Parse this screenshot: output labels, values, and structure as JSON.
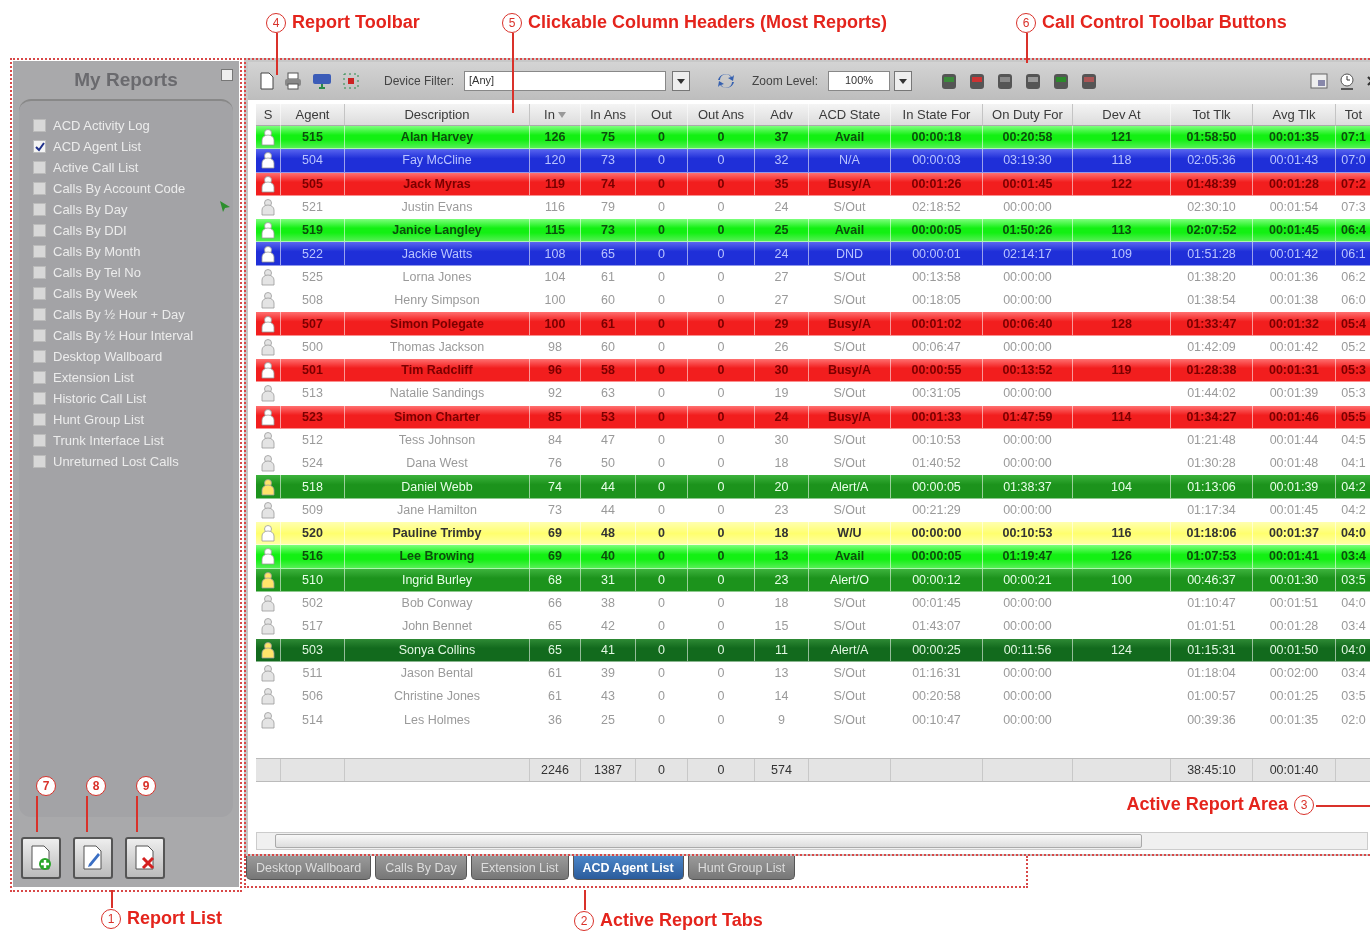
{
  "callouts": [
    {
      "number": "4",
      "label": "Report Toolbar"
    },
    {
      "number": "5",
      "label": "Clickable Column Headers (Most Reports)"
    },
    {
      "number": "6",
      "label": "Call Control Toolbar Buttons"
    },
    {
      "number": "3",
      "label": "Active Report Area"
    },
    {
      "number": "1",
      "label": "Report List"
    },
    {
      "number": "2",
      "label": "Active Report Tabs"
    }
  ],
  "markers": [
    {
      "number": "7"
    },
    {
      "number": "8"
    },
    {
      "number": "9"
    }
  ],
  "sidebar": {
    "title": "My Reports",
    "items": [
      {
        "label": "ACD Activity Log",
        "checked": false
      },
      {
        "label": "ACD Agent List",
        "checked": true
      },
      {
        "label": "Active Call List",
        "checked": false
      },
      {
        "label": "Calls By Account Code",
        "checked": false
      },
      {
        "label": "Calls By Day",
        "checked": false
      },
      {
        "label": "Calls By DDI",
        "checked": false
      },
      {
        "label": "Calls By Month",
        "checked": false
      },
      {
        "label": "Calls By Tel No",
        "checked": false
      },
      {
        "label": "Calls By Week",
        "checked": false
      },
      {
        "label": "Calls By ½ Hour + Day",
        "checked": false
      },
      {
        "label": "Calls By ½ Hour Interval",
        "checked": false
      },
      {
        "label": "Desktop Wallboard",
        "checked": false
      },
      {
        "label": "Extension List",
        "checked": false
      },
      {
        "label": "Historic Call List",
        "checked": false
      },
      {
        "label": "Hunt Group List",
        "checked": false
      },
      {
        "label": "Trunk Interface List",
        "checked": false
      },
      {
        "label": "Unreturned Lost Calls",
        "checked": false
      }
    ],
    "buttons": [
      {
        "kind": "add"
      },
      {
        "kind": "edit"
      },
      {
        "kind": "delete"
      }
    ]
  },
  "toolbar": {
    "device_filter_label": "Device Filter:",
    "device_filter_value": "[Any]",
    "zoom_label": "Zoom Level:",
    "zoom_value": "100%"
  },
  "table": {
    "columns": [
      {
        "label": "S",
        "sorted": false
      },
      {
        "label": "Agent",
        "sorted": false
      },
      {
        "label": "Description",
        "sorted": false
      },
      {
        "label": "In",
        "sorted": true
      },
      {
        "label": "In Ans",
        "sorted": false
      },
      {
        "label": "Out",
        "sorted": false
      },
      {
        "label": "Out Ans",
        "sorted": false
      },
      {
        "label": "Adv",
        "sorted": false
      },
      {
        "label": "ACD State",
        "sorted": false
      },
      {
        "label": "In State For",
        "sorted": false
      },
      {
        "label": "On Duty For",
        "sorted": false
      },
      {
        "label": "Dev At",
        "sorted": false
      },
      {
        "label": "Tot Tlk",
        "sorted": false
      },
      {
        "label": "Avg Tlk",
        "sorted": false
      },
      {
        "label": "Tot",
        "sorted": false
      }
    ],
    "rows": [
      {
        "kind": "avail",
        "agent": "515",
        "description": "Alan Harvey",
        "in": "126",
        "in_ans": "75",
        "out": "0",
        "out_ans": "0",
        "adv": "37",
        "acd_state": "Avail",
        "in_state_for": "00:00:18",
        "on_duty_for": "00:20:58",
        "dev_at": "121",
        "tot_tlk": "01:58:50",
        "avg_tlk": "00:01:35",
        "tot": "07:1"
      },
      {
        "kind": "unavailable",
        "agent": "504",
        "description": "Fay McCline",
        "in": "120",
        "in_ans": "73",
        "out": "0",
        "out_ans": "0",
        "adv": "32",
        "acd_state": "N/A",
        "in_state_for": "00:00:03",
        "on_duty_for": "03:19:30",
        "dev_at": "118",
        "tot_tlk": "02:05:36",
        "avg_tlk": "00:01:43",
        "tot": "07:0"
      },
      {
        "kind": "busy",
        "agent": "505",
        "description": "Jack Myras",
        "in": "119",
        "in_ans": "74",
        "out": "0",
        "out_ans": "0",
        "adv": "35",
        "acd_state": "Busy/A",
        "in_state_for": "00:01:26",
        "on_duty_for": "00:01:45",
        "dev_at": "122",
        "tot_tlk": "01:48:39",
        "avg_tlk": "00:01:28",
        "tot": "07:2"
      },
      {
        "kind": "signedout",
        "agent": "521",
        "description": "Justin Evans",
        "in": "116",
        "in_ans": "79",
        "out": "0",
        "out_ans": "0",
        "adv": "24",
        "acd_state": "S/Out",
        "in_state_for": "02:18:52",
        "on_duty_for": "00:00:00",
        "tot_tlk": "02:30:10",
        "avg_tlk": "00:01:54",
        "tot": "07:3"
      },
      {
        "kind": "avail",
        "agent": "519",
        "description": "Janice Langley",
        "in": "115",
        "in_ans": "73",
        "out": "0",
        "out_ans": "0",
        "adv": "25",
        "acd_state": "Avail",
        "in_state_for": "00:00:05",
        "on_duty_for": "01:50:26",
        "dev_at": "113",
        "tot_tlk": "02:07:52",
        "avg_tlk": "00:01:45",
        "tot": "06:4"
      },
      {
        "kind": "unavailable",
        "agent": "522",
        "description": "Jackie Watts",
        "in": "108",
        "in_ans": "65",
        "out": "0",
        "out_ans": "0",
        "adv": "24",
        "acd_state": "DND",
        "in_state_for": "00:00:01",
        "on_duty_for": "02:14:17",
        "dev_at": "109",
        "tot_tlk": "01:51:28",
        "avg_tlk": "00:01:42",
        "tot": "06:1"
      },
      {
        "kind": "signedout",
        "agent": "525",
        "description": "Lorna Jones",
        "in": "104",
        "in_ans": "61",
        "out": "0",
        "out_ans": "0",
        "adv": "27",
        "acd_state": "S/Out",
        "in_state_for": "00:13:58",
        "on_duty_for": "00:00:00",
        "tot_tlk": "01:38:20",
        "avg_tlk": "00:01:36",
        "tot": "06:2"
      },
      {
        "kind": "signedout",
        "agent": "508",
        "description": "Henry Simpson",
        "in": "100",
        "in_ans": "60",
        "out": "0",
        "out_ans": "0",
        "adv": "27",
        "acd_state": "S/Out",
        "in_state_for": "00:18:05",
        "on_duty_for": "00:00:00",
        "tot_tlk": "01:38:54",
        "avg_tlk": "00:01:38",
        "tot": "06:0"
      },
      {
        "kind": "busy",
        "agent": "507",
        "description": "Simon Polegate",
        "in": "100",
        "in_ans": "61",
        "out": "0",
        "out_ans": "0",
        "adv": "29",
        "acd_state": "Busy/A",
        "in_state_for": "00:01:02",
        "on_duty_for": "00:06:40",
        "dev_at": "128",
        "tot_tlk": "01:33:47",
        "avg_tlk": "00:01:32",
        "tot": "05:4"
      },
      {
        "kind": "signedout",
        "agent": "500",
        "description": "Thomas Jackson",
        "in": "98",
        "in_ans": "60",
        "out": "0",
        "out_ans": "0",
        "adv": "26",
        "acd_state": "S/Out",
        "in_state_for": "00:06:47",
        "on_duty_for": "00:00:00",
        "tot_tlk": "01:42:09",
        "avg_tlk": "00:01:42",
        "tot": "05:2"
      },
      {
        "kind": "busy",
        "agent": "501",
        "description": "Tim Radcliff",
        "in": "96",
        "in_ans": "58",
        "out": "0",
        "out_ans": "0",
        "adv": "30",
        "acd_state": "Busy/A",
        "in_state_for": "00:00:55",
        "on_duty_for": "00:13:52",
        "dev_at": "119",
        "tot_tlk": "01:28:38",
        "avg_tlk": "00:01:31",
        "tot": "05:3"
      },
      {
        "kind": "signedout",
        "agent": "513",
        "description": "Natalie Sandings",
        "in": "92",
        "in_ans": "63",
        "out": "0",
        "out_ans": "0",
        "adv": "19",
        "acd_state": "S/Out",
        "in_state_for": "00:31:05",
        "on_duty_for": "00:00:00",
        "tot_tlk": "01:44:02",
        "avg_tlk": "00:01:39",
        "tot": "05:3"
      },
      {
        "kind": "busy",
        "agent": "523",
        "description": "Simon Charter",
        "in": "85",
        "in_ans": "53",
        "out": "0",
        "out_ans": "0",
        "adv": "24",
        "acd_state": "Busy/A",
        "in_state_for": "00:01:33",
        "on_duty_for": "01:47:59",
        "dev_at": "114",
        "tot_tlk": "01:34:27",
        "avg_tlk": "00:01:46",
        "tot": "05:5"
      },
      {
        "kind": "signedout",
        "agent": "512",
        "description": "Tess Johnson",
        "in": "84",
        "in_ans": "47",
        "out": "0",
        "out_ans": "0",
        "adv": "30",
        "acd_state": "S/Out",
        "in_state_for": "00:10:53",
        "on_duty_for": "00:00:00",
        "tot_tlk": "01:21:48",
        "avg_tlk": "00:01:44",
        "tot": "04:5"
      },
      {
        "kind": "signedout",
        "agent": "524",
        "description": "Dana West",
        "in": "76",
        "in_ans": "50",
        "out": "0",
        "out_ans": "0",
        "adv": "18",
        "acd_state": "S/Out",
        "in_state_for": "01:40:52",
        "on_duty_for": "00:00:00",
        "tot_tlk": "01:30:28",
        "avg_tlk": "00:01:48",
        "tot": "04:1"
      },
      {
        "kind": "alerting",
        "agent": "518",
        "description": "Daniel Webb",
        "in": "74",
        "in_ans": "44",
        "out": "0",
        "out_ans": "0",
        "adv": "20",
        "acd_state": "Alert/A",
        "in_state_for": "00:00:05",
        "on_duty_for": "01:38:37",
        "dev_at": "104",
        "tot_tlk": "01:13:06",
        "avg_tlk": "00:01:39",
        "tot": "04:2"
      },
      {
        "kind": "signedout",
        "agent": "509",
        "description": "Jane Hamilton",
        "in": "73",
        "in_ans": "44",
        "out": "0",
        "out_ans": "0",
        "adv": "23",
        "acd_state": "S/Out",
        "in_state_for": "00:21:29",
        "on_duty_for": "00:00:00",
        "tot_tlk": "01:17:34",
        "avg_tlk": "00:01:45",
        "tot": "04:2"
      },
      {
        "kind": "wrapup",
        "agent": "520",
        "description": "Pauline Trimby",
        "in": "69",
        "in_ans": "48",
        "out": "0",
        "out_ans": "0",
        "adv": "18",
        "acd_state": "W/U",
        "in_state_for": "00:00:00",
        "on_duty_for": "00:10:53",
        "dev_at": "116",
        "tot_tlk": "01:18:06",
        "avg_tlk": "00:01:37",
        "tot": "04:0"
      },
      {
        "kind": "avail",
        "agent": "516",
        "description": "Lee Browing",
        "in": "69",
        "in_ans": "40",
        "out": "0",
        "out_ans": "0",
        "adv": "13",
        "acd_state": "Avail",
        "in_state_for": "00:00:05",
        "on_duty_for": "01:19:47",
        "dev_at": "126",
        "tot_tlk": "01:07:53",
        "avg_tlk": "00:01:41",
        "tot": "03:4"
      },
      {
        "kind": "alerting",
        "agent": "510",
        "description": "Ingrid Burley",
        "in": "68",
        "in_ans": "31",
        "out": "0",
        "out_ans": "0",
        "adv": "23",
        "acd_state": "Alert/O",
        "in_state_for": "00:00:12",
        "on_duty_for": "00:00:21",
        "dev_at": "100",
        "tot_tlk": "00:46:37",
        "avg_tlk": "00:01:30",
        "tot": "03:5"
      },
      {
        "kind": "signedout",
        "agent": "502",
        "description": "Bob Conway",
        "in": "66",
        "in_ans": "38",
        "out": "0",
        "out_ans": "0",
        "adv": "18",
        "acd_state": "S/Out",
        "in_state_for": "00:01:45",
        "on_duty_for": "00:00:00",
        "tot_tlk": "01:10:47",
        "avg_tlk": "00:01:51",
        "tot": "04:0"
      },
      {
        "kind": "signedout",
        "agent": "517",
        "description": "John Bennet",
        "in": "65",
        "in_ans": "42",
        "out": "0",
        "out_ans": "0",
        "adv": "15",
        "acd_state": "S/Out",
        "in_state_for": "01:43:07",
        "on_duty_for": "00:00:00",
        "tot_tlk": "01:01:51",
        "avg_tlk": "00:01:28",
        "tot": "03:4"
      },
      {
        "kind": "alertlong",
        "agent": "503",
        "description": "Sonya Collins",
        "in": "65",
        "in_ans": "41",
        "out": "0",
        "out_ans": "0",
        "adv": "11",
        "acd_state": "Alert/A",
        "in_state_for": "00:00:25",
        "on_duty_for": "00:11:56",
        "dev_at": "124",
        "tot_tlk": "01:15:31",
        "avg_tlk": "00:01:50",
        "tot": "04:0"
      },
      {
        "kind": "signedout",
        "agent": "511",
        "description": "Jason Bental",
        "in": "61",
        "in_ans": "39",
        "out": "0",
        "out_ans": "0",
        "adv": "13",
        "acd_state": "S/Out",
        "in_state_for": "01:16:31",
        "on_duty_for": "00:00:00",
        "tot_tlk": "01:18:04",
        "avg_tlk": "00:02:00",
        "tot": "03:4"
      },
      {
        "kind": "signedout",
        "agent": "506",
        "description": "Christine Jones",
        "in": "61",
        "in_ans": "43",
        "out": "0",
        "out_ans": "0",
        "adv": "14",
        "acd_state": "S/Out",
        "in_state_for": "00:20:58",
        "on_duty_for": "00:00:00",
        "tot_tlk": "01:00:57",
        "avg_tlk": "00:01:25",
        "tot": "03:5"
      },
      {
        "kind": "signedout",
        "agent": "514",
        "description": "Les Holmes",
        "in": "36",
        "in_ans": "25",
        "out": "0",
        "out_ans": "0",
        "adv": "9",
        "acd_state": "S/Out",
        "in_state_for": "00:10:47",
        "on_duty_for": "00:00:00",
        "tot_tlk": "00:39:36",
        "avg_tlk": "00:01:35",
        "tot": "02:0"
      }
    ],
    "totals": {
      "in": "2246",
      "in_ans": "1387",
      "out": "0",
      "out_ans": "0",
      "adv": "574",
      "tot_tlk": "38:45:10",
      "avg_tlk": "00:01:40"
    }
  },
  "tabs": [
    {
      "label": "Desktop Wallboard",
      "selected": false
    },
    {
      "label": "Calls By Day",
      "selected": false
    },
    {
      "label": "Extension List",
      "selected": false
    },
    {
      "label": "ACD Agent List",
      "selected": true
    },
    {
      "label": "Hunt Group List",
      "selected": false
    }
  ]
}
